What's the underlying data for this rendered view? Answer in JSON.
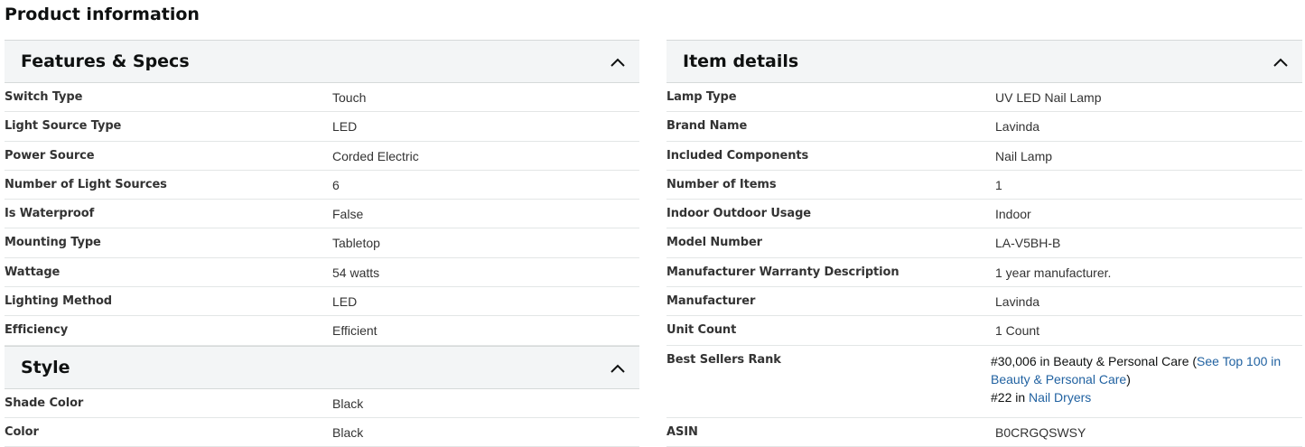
{
  "page_title": "Product information",
  "features": {
    "title": "Features & Specs",
    "rows": [
      {
        "label": "Switch Type",
        "value": "Touch"
      },
      {
        "label": "Light Source Type",
        "value": "LED"
      },
      {
        "label": "Power Source",
        "value": "Corded Electric"
      },
      {
        "label": "Number of Light Sources",
        "value": "6"
      },
      {
        "label": "Is Waterproof",
        "value": "False"
      },
      {
        "label": "Mounting Type",
        "value": "Tabletop"
      },
      {
        "label": "Wattage",
        "value": "54 watts"
      },
      {
        "label": "Lighting Method",
        "value": "LED"
      },
      {
        "label": "Efficiency",
        "value": "Efficient"
      }
    ]
  },
  "style": {
    "title": "Style",
    "rows": [
      {
        "label": "Shade Color",
        "value": "Black"
      },
      {
        "label": "Color",
        "value": "Black"
      }
    ]
  },
  "item_details": {
    "title": "Item details",
    "rows": [
      {
        "label": "Lamp Type",
        "value": "UV LED Nail Lamp"
      },
      {
        "label": "Brand Name",
        "value": "Lavinda"
      },
      {
        "label": "Included Components",
        "value": "Nail Lamp"
      },
      {
        "label": "Number of Items",
        "value": "1"
      },
      {
        "label": "Indoor Outdoor Usage",
        "value": "Indoor"
      },
      {
        "label": "Model Number",
        "value": "LA-V5BH-B"
      },
      {
        "label": "Manufacturer Warranty Description",
        "value": "1 year manufacturer."
      },
      {
        "label": "Manufacturer",
        "value": "Lavinda"
      },
      {
        "label": "Unit Count",
        "value": "1 Count"
      }
    ],
    "best_sellers": {
      "label": "Best Sellers Rank",
      "rank1": "#30,006 in Beauty & Personal Care (",
      "rank1_link": "See Top 100 in Beauty & Personal Care",
      "rank1_close": ")",
      "rank2": "#22 in ",
      "rank2_link": "Nail Dryers"
    },
    "asin": {
      "label": "ASIN",
      "value": "B0CRGQSWSY"
    }
  }
}
